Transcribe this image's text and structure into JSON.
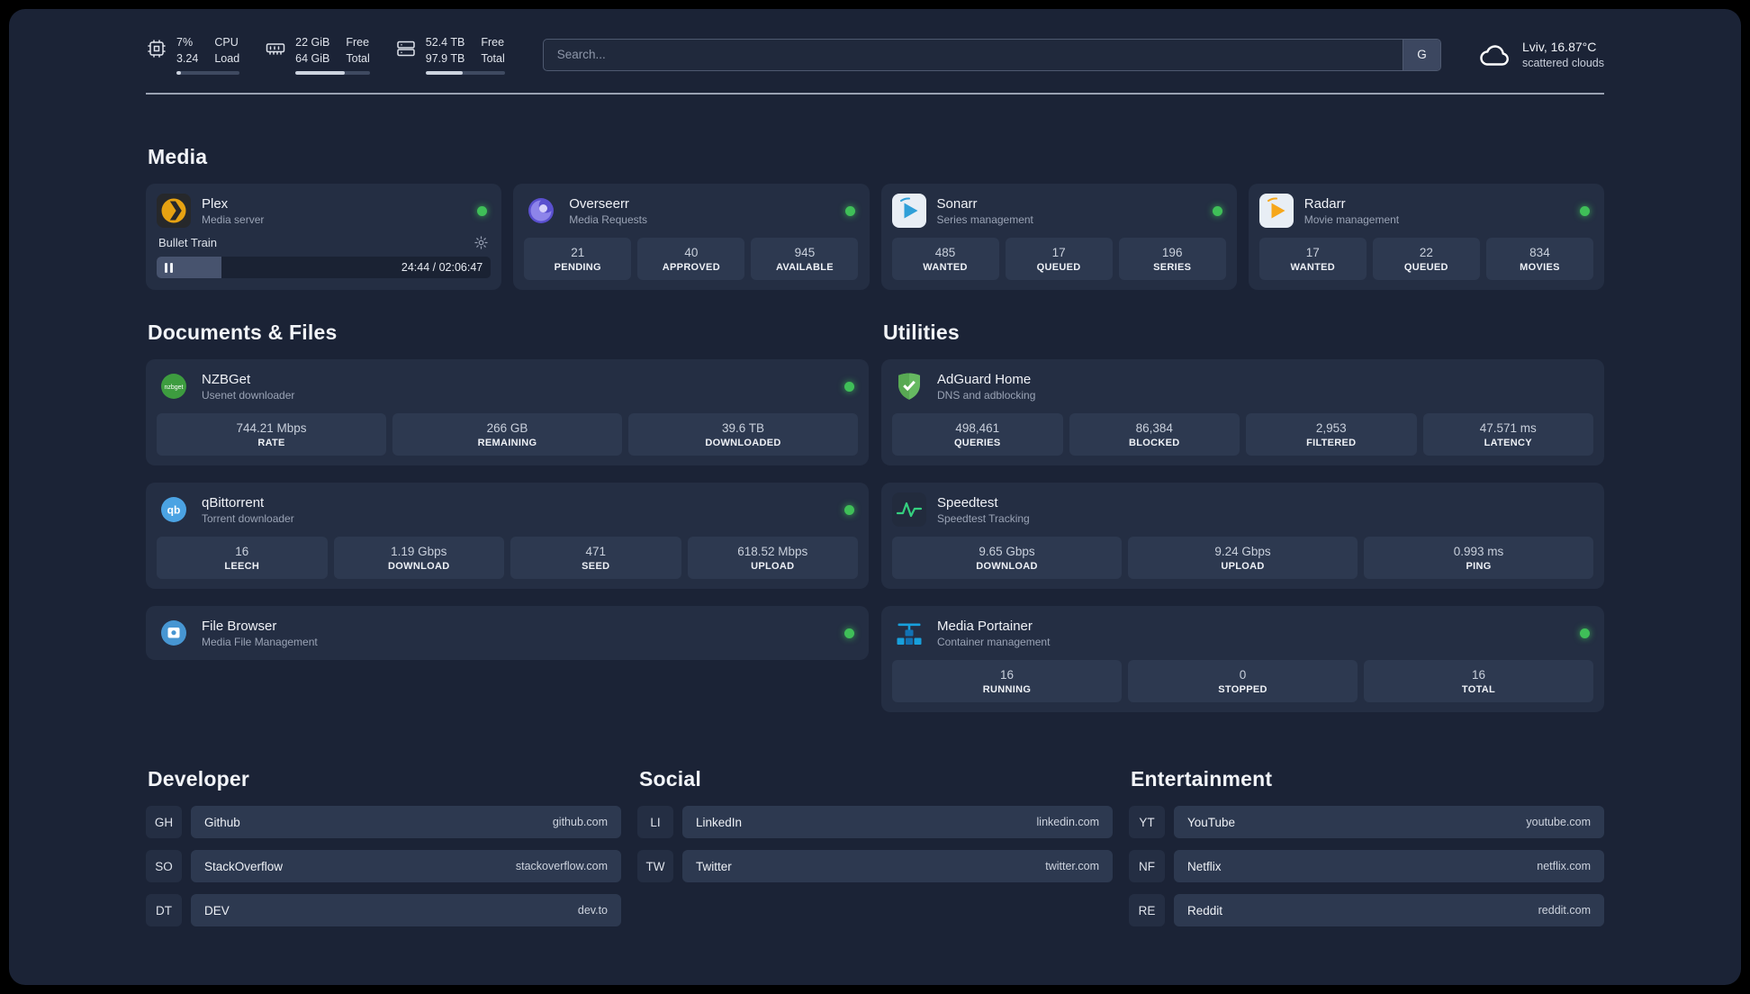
{
  "topbar": {
    "monitors": [
      {
        "icon": "cpu-icon",
        "value1": "7%",
        "value2": "3.24",
        "label1": "CPU",
        "label2": "Load",
        "bar_percent": 7
      },
      {
        "icon": "ram-icon",
        "value1": "22 GiB",
        "value2": "64 GiB",
        "label1": "Free",
        "label2": "Total",
        "bar_percent": 66
      },
      {
        "icon": "disk-icon",
        "value1": "52.4 TB",
        "value2": "97.9 TB",
        "label1": "Free",
        "label2": "Total",
        "bar_percent": 47
      }
    ],
    "search": {
      "placeholder": "Search...",
      "engine_button": "G"
    },
    "weather": {
      "location": "Lviv, 16.87°C",
      "condition": "scattered clouds"
    }
  },
  "sections": {
    "media": {
      "title": "Media",
      "apps": [
        {
          "name": "Plex",
          "subtitle": "Media server",
          "status": "online",
          "player": {
            "track": "Bullet Train",
            "time": "24:44 / 02:06:47",
            "progress_percent": 19.5
          }
        },
        {
          "name": "Overseerr",
          "subtitle": "Media Requests",
          "status": "online",
          "stats": [
            {
              "value": "21",
              "label": "PENDING"
            },
            {
              "value": "40",
              "label": "APPROVED"
            },
            {
              "value": "945",
              "label": "AVAILABLE"
            }
          ]
        },
        {
          "name": "Sonarr",
          "subtitle": "Series management",
          "status": "online",
          "stats": [
            {
              "value": "485",
              "label": "WANTED"
            },
            {
              "value": "17",
              "label": "QUEUED"
            },
            {
              "value": "196",
              "label": "SERIES"
            }
          ]
        },
        {
          "name": "Radarr",
          "subtitle": "Movie management",
          "status": "online",
          "stats": [
            {
              "value": "17",
              "label": "WANTED"
            },
            {
              "value": "22",
              "label": "QUEUED"
            },
            {
              "value": "834",
              "label": "MOVIES"
            }
          ]
        }
      ]
    },
    "documents": {
      "title": "Documents & Files",
      "apps": [
        {
          "name": "NZBGet",
          "subtitle": "Usenet downloader",
          "status": "online",
          "stats": [
            {
              "value": "744.21 Mbps",
              "label": "RATE"
            },
            {
              "value": "266 GB",
              "label": "REMAINING"
            },
            {
              "value": "39.6 TB",
              "label": "DOWNLOADED"
            }
          ]
        },
        {
          "name": "qBittorrent",
          "subtitle": "Torrent downloader",
          "status": "online",
          "stats": [
            {
              "value": "16",
              "label": "LEECH"
            },
            {
              "value": "1.19 Gbps",
              "label": "DOWNLOAD"
            },
            {
              "value": "471",
              "label": "SEED"
            },
            {
              "value": "618.52 Mbps",
              "label": "UPLOAD"
            }
          ]
        },
        {
          "name": "File Browser",
          "subtitle": "Media File Management",
          "status": "online"
        }
      ]
    },
    "utilities": {
      "title": "Utilities",
      "apps": [
        {
          "name": "AdGuard Home",
          "subtitle": "DNS and adblocking",
          "stats": [
            {
              "value": "498,461",
              "label": "QUERIES"
            },
            {
              "value": "86,384",
              "label": "BLOCKED"
            },
            {
              "value": "2,953",
              "label": "FILTERED"
            },
            {
              "value": "47.571 ms",
              "label": "LATENCY"
            }
          ]
        },
        {
          "name": "Speedtest",
          "subtitle": "Speedtest Tracking",
          "stats": [
            {
              "value": "9.65 Gbps",
              "label": "DOWNLOAD"
            },
            {
              "value": "9.24 Gbps",
              "label": "UPLOAD"
            },
            {
              "value": "0.993 ms",
              "label": "PING"
            }
          ]
        },
        {
          "name": "Media Portainer",
          "subtitle": "Container management",
          "status": "online",
          "stats": [
            {
              "value": "16",
              "label": "RUNNING"
            },
            {
              "value": "0",
              "label": "STOPPED"
            },
            {
              "value": "16",
              "label": "TOTAL"
            }
          ]
        }
      ]
    }
  },
  "bookmarks": [
    {
      "title": "Developer",
      "links": [
        {
          "abbr": "GH",
          "name": "Github",
          "url": "github.com"
        },
        {
          "abbr": "SO",
          "name": "StackOverflow",
          "url": "stackoverflow.com"
        },
        {
          "abbr": "DT",
          "name": "DEV",
          "url": "dev.to"
        }
      ]
    },
    {
      "title": "Social",
      "links": [
        {
          "abbr": "LI",
          "name": "LinkedIn",
          "url": "linkedin.com"
        },
        {
          "abbr": "TW",
          "name": "Twitter",
          "url": "twitter.com"
        }
      ]
    },
    {
      "title": "Entertainment",
      "links": [
        {
          "abbr": "YT",
          "name": "YouTube",
          "url": "youtube.com"
        },
        {
          "abbr": "NF",
          "name": "Netflix",
          "url": "netflix.com"
        },
        {
          "abbr": "RE",
          "name": "Reddit",
          "url": "reddit.com"
        }
      ]
    }
  ],
  "colors": {
    "status_online": "#3fbf58",
    "background": "#1b2336",
    "card": "#242e43",
    "tile": "#2d3950"
  }
}
